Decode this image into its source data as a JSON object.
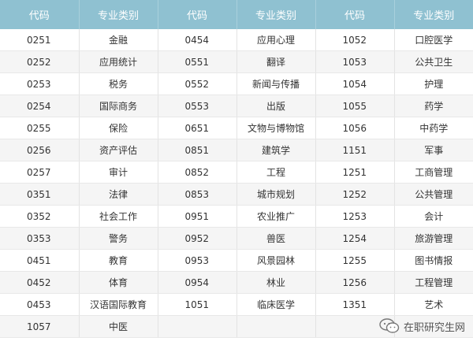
{
  "table": {
    "headers": [
      "代码",
      "专业类别",
      "代码",
      "专业类别",
      "代码",
      "专业类别"
    ],
    "rows": [
      [
        "0251",
        "金融",
        "0454",
        "应用心理",
        "1052",
        "口腔医学"
      ],
      [
        "0252",
        "应用统计",
        "0551",
        "翻译",
        "1053",
        "公共卫生"
      ],
      [
        "0253",
        "税务",
        "0552",
        "新闻与传播",
        "1054",
        "护理"
      ],
      [
        "0254",
        "国际商务",
        "0553",
        "出版",
        "1055",
        "药学"
      ],
      [
        "0255",
        "保险",
        "0651",
        "文物与博物馆",
        "1056",
        "中药学"
      ],
      [
        "0256",
        "资产评估",
        "0851",
        "建筑学",
        "1151",
        "军事"
      ],
      [
        "0257",
        "审计",
        "0852",
        "工程",
        "1251",
        "工商管理"
      ],
      [
        "0351",
        "法律",
        "0853",
        "城市规划",
        "1252",
        "公共管理"
      ],
      [
        "0352",
        "社会工作",
        "0951",
        "农业推广",
        "1253",
        "会计"
      ],
      [
        "0353",
        "警务",
        "0952",
        "兽医",
        "1254",
        "旅游管理"
      ],
      [
        "0451",
        "教育",
        "0953",
        "风景园林",
        "1255",
        "图书情报"
      ],
      [
        "0452",
        "体育",
        "0954",
        "林业",
        "1256",
        "工程管理"
      ],
      [
        "0453",
        "汉语国际教育",
        "1051",
        "临床医学",
        "1351",
        "艺术"
      ],
      [
        "1057",
        "中医",
        "",
        "",
        "",
        ""
      ]
    ]
  },
  "watermark": {
    "text": "在职研究生网",
    "icon": "wechat-icon"
  }
}
